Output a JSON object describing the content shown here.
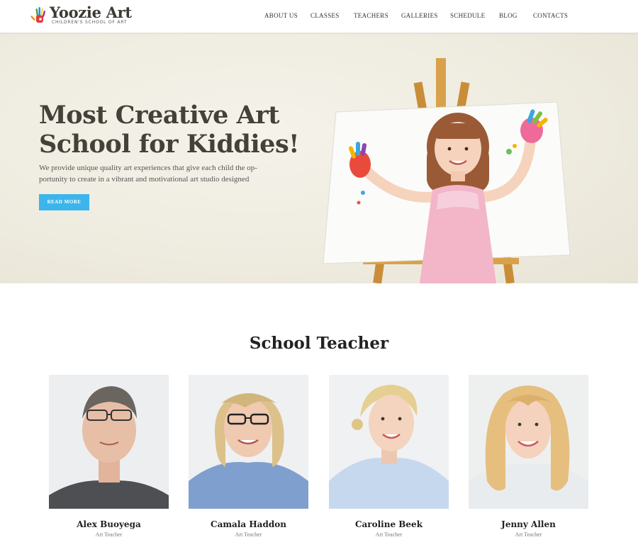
{
  "brand": {
    "name": "Yoozie Art",
    "tagline": "CHILDREN'S SCHOOL OF ART",
    "colors": {
      "accent": "#3cb5ec",
      "text_dark": "#45413a"
    },
    "logo_icon": "painted-hand-icon"
  },
  "nav": {
    "items": [
      {
        "label": "ABOUT US"
      },
      {
        "label": "CLASSES"
      },
      {
        "label": "TEACHERS"
      },
      {
        "label": "GALLERIES"
      },
      {
        "label": "SCHEDULE"
      },
      {
        "label": "BLOG"
      },
      {
        "label": "CONTACTS"
      }
    ]
  },
  "hero": {
    "title_line1": "Most Creative Art",
    "title_line2": "School for Kiddies!",
    "text_line1": "We provide unique quality art experiences that give each child the op-",
    "text_line2": "portunity to create in a vibrant and motivational art studio designed",
    "button_label": "READ MORE"
  },
  "teachers": {
    "title": "School Teacher",
    "items": [
      {
        "name": "Alex Buoyega",
        "role": "Art Teacher"
      },
      {
        "name": "Camala Haddon",
        "role": "Art Teacher"
      },
      {
        "name": "Caroline Beek",
        "role": "Art Teacher"
      },
      {
        "name": "Jenny Allen",
        "role": "Art Teacher"
      }
    ]
  }
}
